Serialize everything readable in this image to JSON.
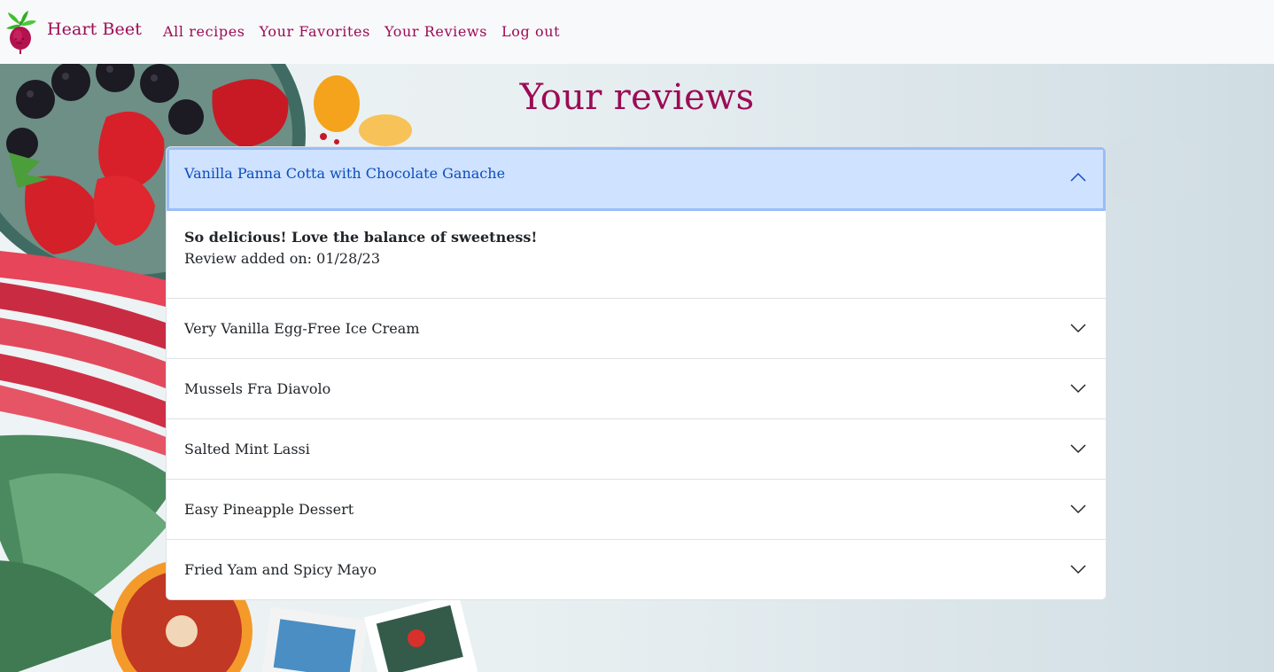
{
  "navbar": {
    "brand": "Heart Beet",
    "links": [
      "All recipes",
      "Your Favorites",
      "Your Reviews",
      "Log out"
    ]
  },
  "page": {
    "title": "Your reviews"
  },
  "reviews": [
    {
      "recipe": "Vanilla Panna Cotta with Chocolate Ganache",
      "expanded": true,
      "text": "So delicious! Love the balance of sweetness!",
      "date_label": "Review added on: 01/28/23"
    },
    {
      "recipe": "Very Vanilla Egg-Free Ice Cream",
      "expanded": false
    },
    {
      "recipe": "Mussels Fra Diavolo",
      "expanded": false
    },
    {
      "recipe": "Salted Mint Lassi",
      "expanded": false
    },
    {
      "recipe": "Easy Pineapple Dessert",
      "expanded": false
    },
    {
      "recipe": "Fried Yam and Spicy Mayo",
      "expanded": false
    }
  ],
  "colors": {
    "brand": "#9c0b55",
    "active_header_bg": "#cfe2ff",
    "active_header_text": "#0c4dbd"
  },
  "icons": {
    "logo": "beet-logo-icon",
    "expanded": "chevron-up-icon",
    "collapsed": "chevron-down-icon"
  }
}
